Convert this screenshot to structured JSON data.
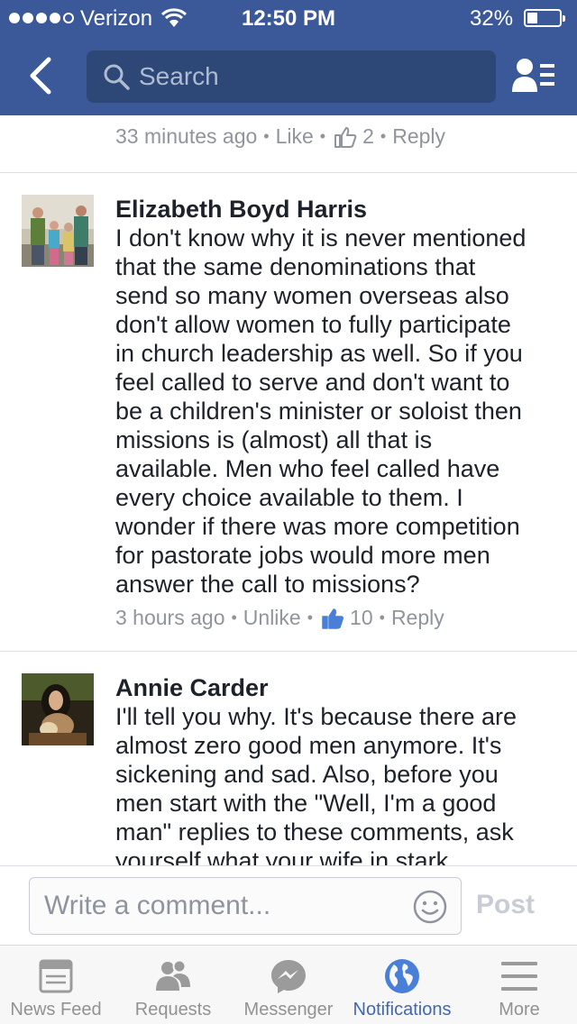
{
  "status_bar": {
    "carrier": "Verizon",
    "time": "12:50 PM",
    "battery": "32%"
  },
  "nav": {
    "search_placeholder": "Search"
  },
  "previous_comment": {
    "time": "33 minutes ago",
    "like": "Like",
    "likes": "2",
    "reply": "Reply"
  },
  "comments": [
    {
      "author": "Elizabeth Boyd Harris",
      "text_lines": [
        "I don't know why it is never mentioned",
        "that the same denominations that",
        "send so many women overseas also",
        "don't allow women to fully participate",
        "in church leadership as well. So if you",
        "feel called to serve and don't want to",
        "be a children's minister or soloist then",
        "missions is (almost) all that is",
        "available. Men who feel called have",
        "every choice available to them. I",
        "wonder if there was more competition",
        "for pastorate jobs would more men",
        "answer the call to missions?"
      ],
      "time": "3 hours ago",
      "like": "Unlike",
      "likes": "10",
      "reply": "Reply"
    },
    {
      "author": "Annie Carder",
      "text_lines": [
        "I'll tell you why. It's because there are",
        "almost zero good men anymore. It's",
        "sickening and sad. Also, before you",
        "men start with the \"Well, I'm a good",
        "man\" replies to these comments, ask",
        "yourself what your wife in stark"
      ]
    }
  ],
  "composer": {
    "placeholder": "Write a comment...",
    "post_label": "Post"
  },
  "tabs": [
    {
      "label": "News Feed",
      "icon": "news-feed-icon"
    },
    {
      "label": "Requests",
      "icon": "friend-requests-icon"
    },
    {
      "label": "Messenger",
      "icon": "messenger-icon"
    },
    {
      "label": "Notifications",
      "icon": "globe-icon",
      "active": true
    },
    {
      "label": "More",
      "icon": "menu-icon"
    }
  ],
  "colors": {
    "brand": "#3b5998",
    "active_tab": "#4267b2",
    "meta_gray": "#90949c"
  }
}
